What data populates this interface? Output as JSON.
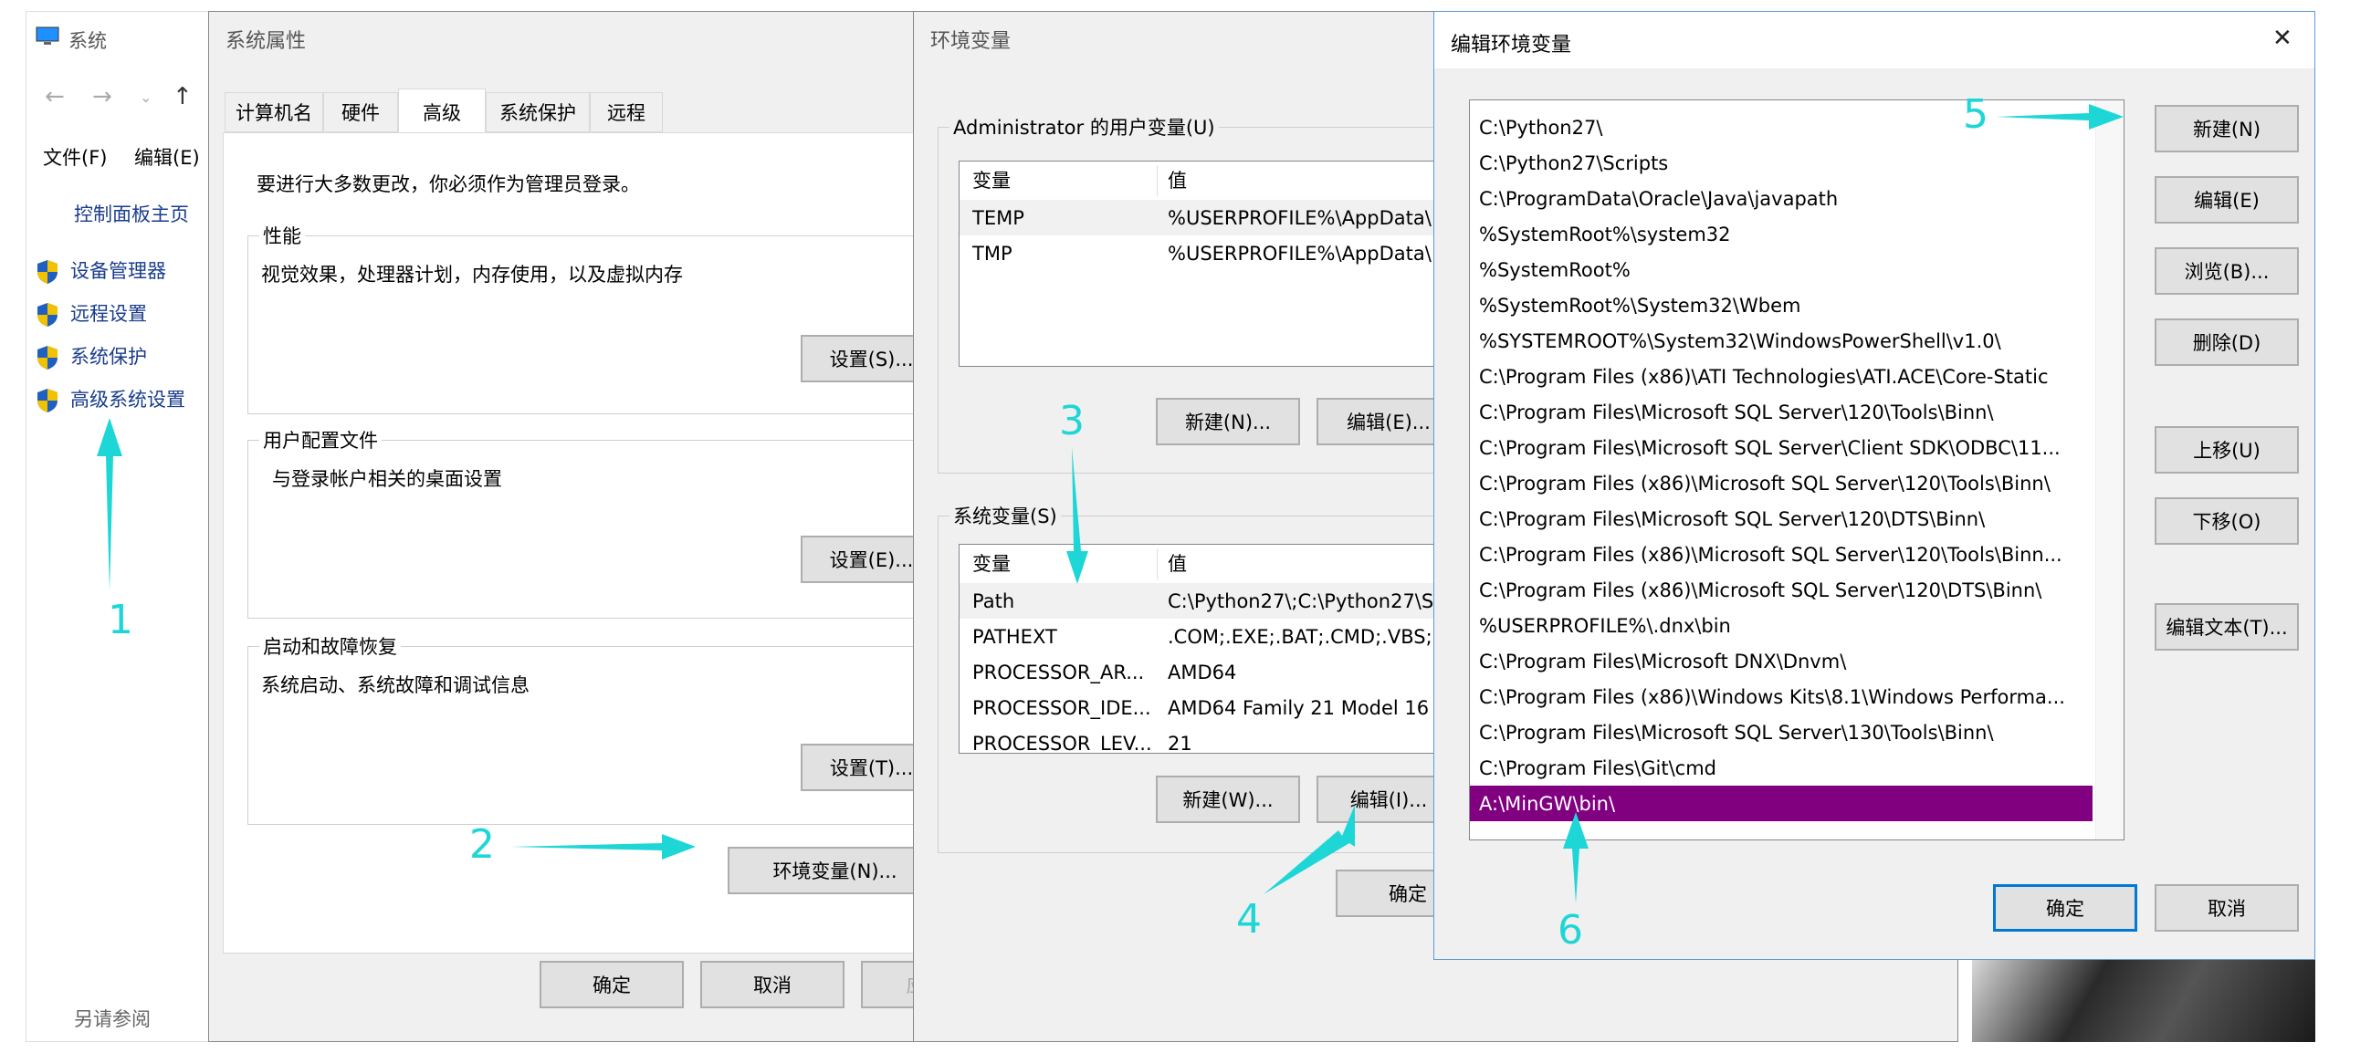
{
  "system_window": {
    "title": "系统",
    "menu": [
      "文件(F)",
      "编辑(E)"
    ],
    "control_panel_home": "控制面板主页",
    "links": [
      "设备管理器",
      "远程设置",
      "系统保护",
      "高级系统设置"
    ],
    "see_also": "另请参阅"
  },
  "sysprops": {
    "title": "系统属性",
    "tabs": [
      "计算机名",
      "硬件",
      "高级",
      "系统保护",
      "远程"
    ],
    "admin_note": "要进行大多数更改，你必须作为管理员登录。",
    "performance": {
      "label": "性能",
      "desc": "视觉效果，处理器计划，内存使用，以及虚拟内存",
      "button": "设置(S)..."
    },
    "profile": {
      "label": "用户配置文件",
      "desc": "与登录帐户相关的桌面设置",
      "button": "设置(E)..."
    },
    "startup": {
      "label": "启动和故障恢复",
      "desc": "系统启动、系统故障和调试信息",
      "button": "设置(T)..."
    },
    "env_button": "环境变量(N)...",
    "ok": "确定",
    "cancel": "取消",
    "apply": "应"
  },
  "envvars": {
    "title": "环境变量",
    "user_label": "Administrator 的用户变量(U)",
    "col_var": "变量",
    "col_val": "值",
    "user_rows": [
      {
        "name": "TEMP",
        "value": "%USERPROFILE%\\AppData\\"
      },
      {
        "name": "TMP",
        "value": "%USERPROFILE%\\AppData\\"
      }
    ],
    "user_new": "新建(N)...",
    "user_edit": "编辑(E)...",
    "sys_label": "系统变量(S)",
    "sys_rows": [
      {
        "name": "Path",
        "value": "C:\\Python27\\;C:\\Python27\\S"
      },
      {
        "name": "PATHEXT",
        "value": ".COM;.EXE;.BAT;.CMD;.VBS;"
      },
      {
        "name": "PROCESSOR_AR...",
        "value": "AMD64"
      },
      {
        "name": "PROCESSOR_IDE...",
        "value": "AMD64 Family 21 Model 16"
      },
      {
        "name": "PROCESSOR_LEV...",
        "value": "21"
      }
    ],
    "sys_new": "新建(W)...",
    "sys_edit": "编辑(I)...",
    "ok": "确定"
  },
  "editenv": {
    "title": "编辑环境变量",
    "close": "✕",
    "paths": [
      "C:\\Python27\\",
      "C:\\Python27\\Scripts",
      "C:\\ProgramData\\Oracle\\Java\\javapath",
      "%SystemRoot%\\system32",
      "%SystemRoot%",
      "%SystemRoot%\\System32\\Wbem",
      "%SYSTEMROOT%\\System32\\WindowsPowerShell\\v1.0\\",
      "C:\\Program Files (x86)\\ATI Technologies\\ATI.ACE\\Core-Static",
      "C:\\Program Files\\Microsoft SQL Server\\120\\Tools\\Binn\\",
      "C:\\Program Files\\Microsoft SQL Server\\Client SDK\\ODBC\\11...",
      "C:\\Program Files (x86)\\Microsoft SQL Server\\120\\Tools\\Binn\\",
      "C:\\Program Files\\Microsoft SQL Server\\120\\DTS\\Binn\\",
      "C:\\Program Files (x86)\\Microsoft SQL Server\\120\\Tools\\Binn...",
      "C:\\Program Files (x86)\\Microsoft SQL Server\\120\\DTS\\Binn\\",
      "%USERPROFILE%\\.dnx\\bin",
      "C:\\Program Files\\Microsoft DNX\\Dnvm\\",
      "C:\\Program Files (x86)\\Windows Kits\\8.1\\Windows Performa...",
      "C:\\Program Files\\Microsoft SQL Server\\130\\Tools\\Binn\\",
      "C:\\Program Files\\Git\\cmd",
      "A:\\MinGW\\bin\\"
    ],
    "selected_index": 19,
    "buttons": {
      "new": "新建(N)",
      "edit": "编辑(E)",
      "browse": "浏览(B)...",
      "delete": "删除(D)",
      "up": "上移(U)",
      "down": "下移(O)",
      "edit_text": "编辑文本(T)...",
      "ok": "确定",
      "cancel": "取消"
    }
  },
  "annotations": [
    "1",
    "2",
    "3",
    "4",
    "5",
    "6"
  ],
  "colors": {
    "annotation": "#1ed6d6",
    "selection": "#800080",
    "accent": "#0078d7"
  }
}
